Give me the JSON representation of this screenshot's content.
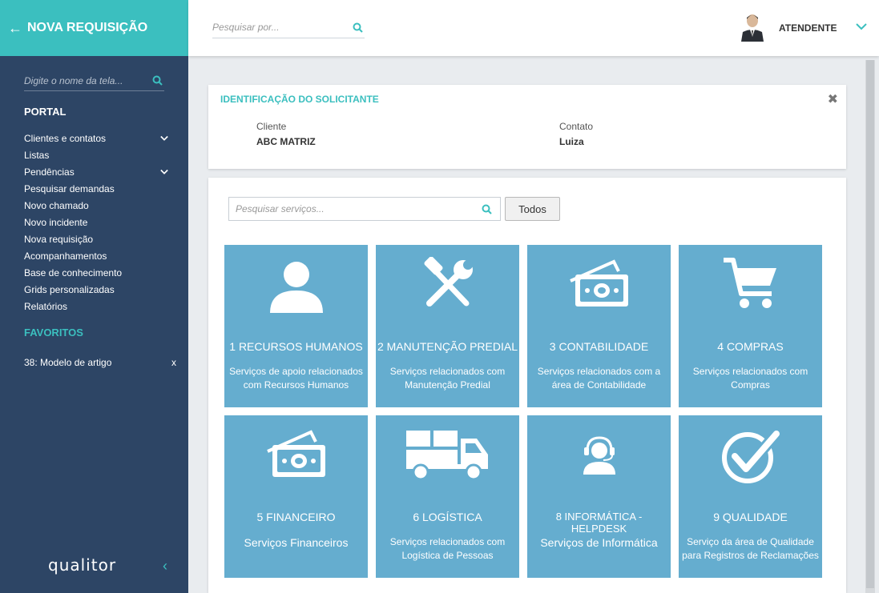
{
  "sidebar": {
    "header_title": "NOVA REQUISIÇÃO",
    "search_placeholder": "Digite o nome da tela...",
    "portal_title": "PORTAL",
    "items": [
      {
        "label": "Clientes e contatos",
        "expandable": true
      },
      {
        "label": "Listas",
        "expandable": false
      },
      {
        "label": "Pendências",
        "expandable": true
      },
      {
        "label": "Pesquisar demandas",
        "expandable": false
      },
      {
        "label": "Novo chamado",
        "expandable": false
      },
      {
        "label": "Novo incidente",
        "expandable": false
      },
      {
        "label": "Nova requisição",
        "expandable": false
      },
      {
        "label": "Acompanhamentos",
        "expandable": false
      },
      {
        "label": "Base de conhecimento",
        "expandable": false
      },
      {
        "label": "Grids personalizadas",
        "expandable": false
      },
      {
        "label": "Relatórios",
        "expandable": false
      }
    ],
    "favorites_title": "FAVORITOS",
    "favorites": [
      {
        "label": "38: Modelo de artigo",
        "remove": "x"
      }
    ],
    "logo": "qualitor"
  },
  "topbar": {
    "search_placeholder": "Pesquisar por...",
    "user_name": "ATENDENTE"
  },
  "identification": {
    "title": "IDENTIFICAÇÃO DO SOLICITANTE",
    "client_label": "Cliente",
    "client_value": "ABC MATRIZ",
    "contact_label": "Contato",
    "contact_value": "Luiza"
  },
  "services": {
    "search_placeholder": "Pesquisar serviços...",
    "all_button": "Todos",
    "tiles": [
      {
        "title": "1 RECURSOS HUMANOS",
        "desc": "Serviços de apoio relacionados com Recursos Humanos",
        "icon": "user-icon"
      },
      {
        "title": "2 MANUTENÇÃO PREDIAL",
        "desc": "Serviços relacionados com Manutenção Predial",
        "icon": "tools-icon"
      },
      {
        "title": "3 CONTABILIDADE",
        "desc": "Serviços relacionados com a área de Contabilidade",
        "icon": "money-icon"
      },
      {
        "title": "4 COMPRAS",
        "desc": "Serviços relacionados com Compras",
        "icon": "cart-icon"
      },
      {
        "title": "5 FINANCEIRO",
        "desc": "Serviços Financeiros",
        "icon": "money-icon"
      },
      {
        "title": "6 LOGÍSTICA",
        "desc": "Serviços relacionados com Logística de Pessoas",
        "icon": "truck-icon"
      },
      {
        "title": "8 INFORMÁTICA - HELPDESK",
        "desc": "Serviços de Informática",
        "icon": "headset-icon"
      },
      {
        "title": "9 QUALIDADE",
        "desc": "Serviço da área de Qualidade para Registros de Reclamações",
        "icon": "check-icon"
      }
    ]
  },
  "colors": {
    "teal": "#3bbfbf",
    "sidebar": "#2d4565",
    "tile": "#65adcf"
  }
}
